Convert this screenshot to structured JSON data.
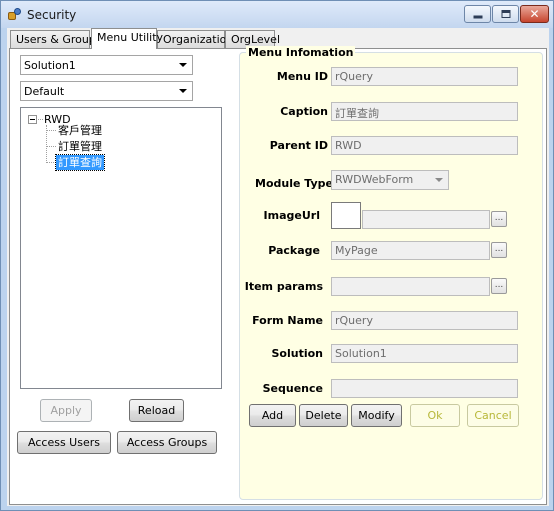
{
  "window": {
    "title": "Security"
  },
  "tabs": [
    {
      "label": "Users & Groups"
    },
    {
      "label": "Menu Utility"
    },
    {
      "label": "Organization"
    },
    {
      "label": "OrgLevel"
    }
  ],
  "left": {
    "solution_select": "Solution1",
    "default_select": "Default",
    "tree": {
      "root": "RWD",
      "children": [
        "客戶管理",
        "訂單管理",
        "訂單查詢"
      ]
    },
    "buttons": {
      "apply": "Apply",
      "reload": "Reload",
      "access_users": "Access Users",
      "access_groups": "Access Groups"
    }
  },
  "menu_info": {
    "title": "Menu Infomation",
    "labels": {
      "menu_id": "Menu ID",
      "caption": "Caption",
      "parent_id": "Parent ID",
      "module_type": "Module Type",
      "image_url": "ImageUrl",
      "package": "Package",
      "item_params": "Item params",
      "form_name": "Form Name",
      "solution": "Solution",
      "sequence": "Sequence"
    },
    "values": {
      "menu_id": "rQuery",
      "caption": "訂單查詢",
      "parent_id": "RWD",
      "module_type": "RWDWebForm",
      "image_url": "",
      "package": "MyPage",
      "item_params": "",
      "form_name": "rQuery",
      "solution": "Solution1",
      "sequence": ""
    },
    "browse_label": "...",
    "buttons": {
      "add": "Add",
      "delete": "Delete",
      "modify": "Modify",
      "ok": "Ok",
      "cancel": "Cancel"
    }
  }
}
